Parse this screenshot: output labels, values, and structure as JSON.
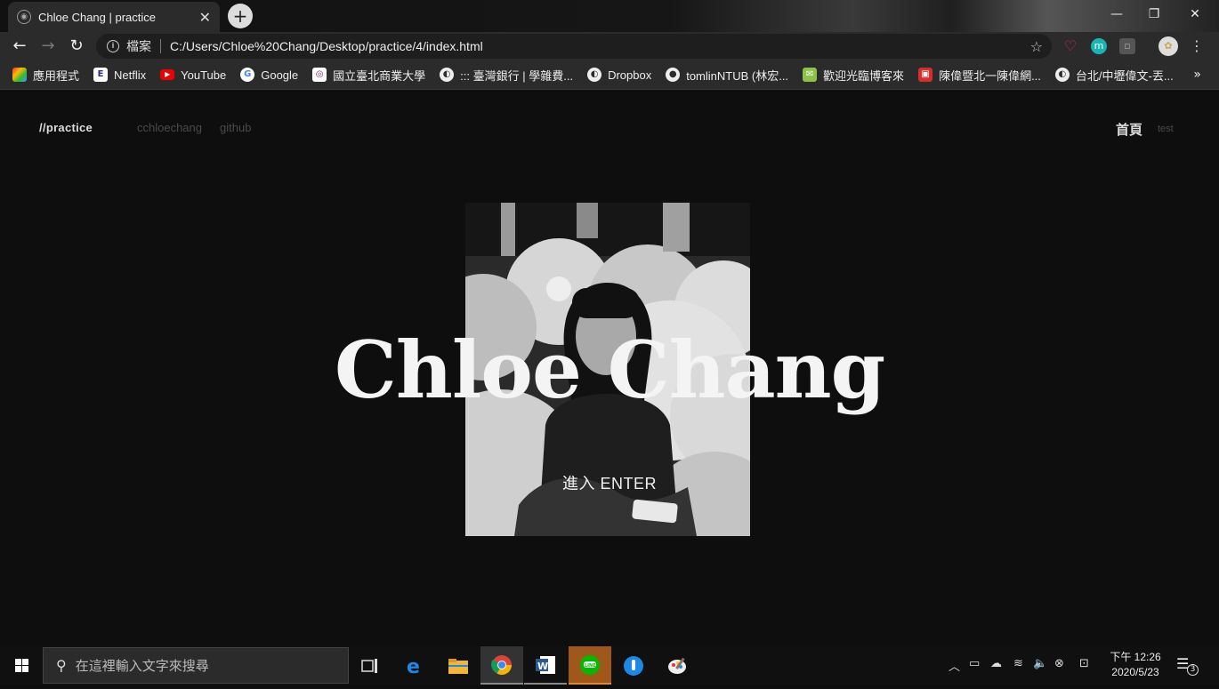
{
  "browser": {
    "tab_title": "Chloe Chang | practice",
    "tab_close": "✕",
    "new_tab": "+",
    "scheme_label": "檔案",
    "url": "C:/Users/Chloe%20Chang/Desktop/practice/4/index.html",
    "window_controls": {
      "minimize": "—",
      "restore": "❐",
      "close": "✕"
    }
  },
  "bookmarks": [
    {
      "label": "應用程式",
      "icon": "apps-grid-icon"
    },
    {
      "label": "Netflix",
      "icon": "netflix-icon"
    },
    {
      "label": "YouTube",
      "icon": "youtube-icon"
    },
    {
      "label": "Google",
      "icon": "google-icon"
    },
    {
      "label": "國立臺北商業大學",
      "icon": "school-icon"
    },
    {
      "label": "::: 臺灣銀行 | 學雜費...",
      "icon": "globe-icon"
    },
    {
      "label": "Dropbox",
      "icon": "globe-icon"
    },
    {
      "label": "tomlinNTUB (林宏...",
      "icon": "github-icon"
    },
    {
      "label": "歡迎光臨博客來",
      "icon": "books-icon"
    },
    {
      "label": "陳偉暨北一陳偉網...",
      "icon": "video-icon"
    },
    {
      "label": "台北/中壢偉文-丟...",
      "icon": "globe-icon"
    }
  ],
  "bookmarks_more": "»",
  "site": {
    "brand": "//practice",
    "links": [
      "cchloechang",
      "github"
    ],
    "nav_home": "首頁",
    "nav_test": "test",
    "hero_title": "Chloe Chang",
    "enter_label": "進入 ENTER"
  },
  "taskbar": {
    "search_placeholder": "在這裡輸入文字來搜尋",
    "clock_time": "下午 12:26",
    "clock_date": "2020/5/23",
    "notification_count": "3"
  },
  "colors": {
    "page_bg": "#0e0e0e",
    "chrome_bg": "#2b2b2b",
    "accent_line": "#00b900"
  }
}
